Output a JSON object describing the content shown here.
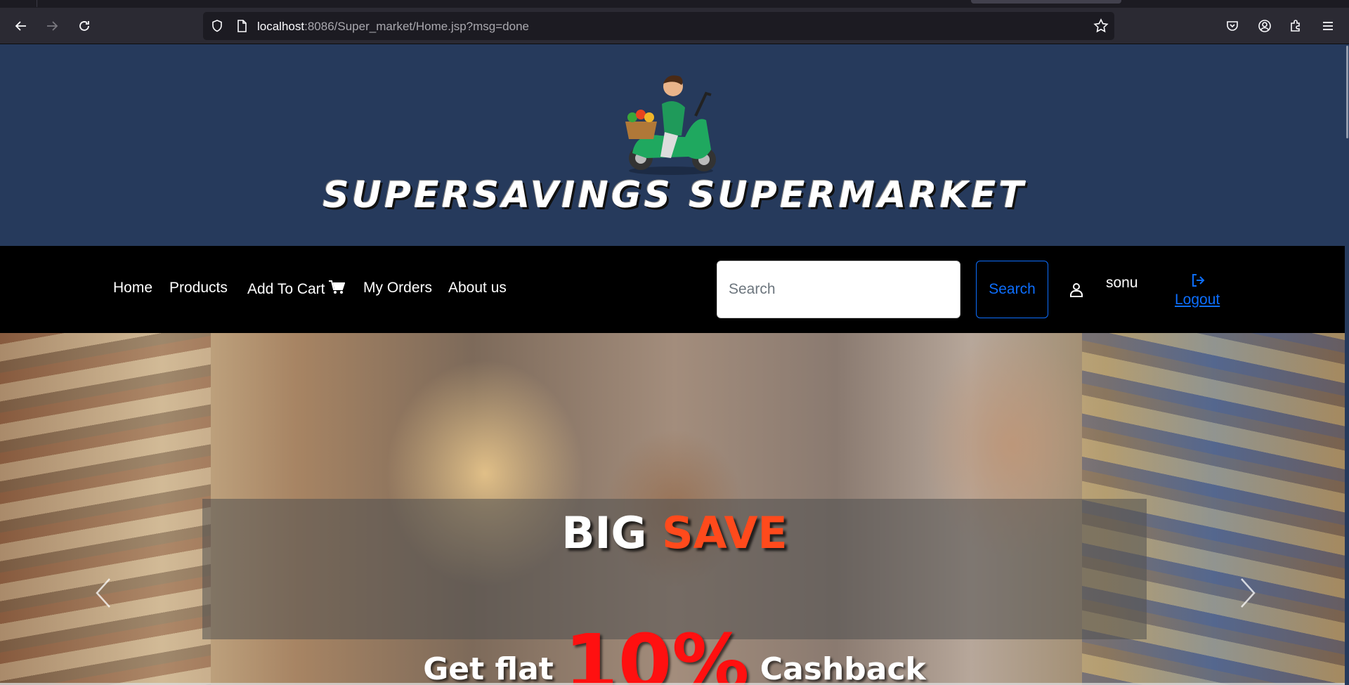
{
  "browser": {
    "url_host": "localhost",
    "url_rest": ":8086/Super_market/Home.jsp?msg=done",
    "icons": [
      "back-icon",
      "forward-icon",
      "reload-icon",
      "shield-icon",
      "page-icon",
      "bookmark-star-icon",
      "pocket-icon",
      "account-icon",
      "extensions-icon",
      "menu-icon"
    ]
  },
  "header": {
    "brand": "SUPERSAVINGS SUPERMARKET",
    "logo": "scooter-delivery-logo",
    "background": "#263a5c"
  },
  "nav": {
    "items": [
      {
        "label": "Home"
      },
      {
        "label": "Products"
      },
      {
        "label": "Add To Cart"
      },
      {
        "label": "My Orders"
      },
      {
        "label": "About us"
      }
    ],
    "search_placeholder": "Search",
    "search_button": "Search",
    "username": "sonu",
    "logout": "Logout",
    "accent": "#0d6efd"
  },
  "banner": {
    "title_part1": "BIG ",
    "title_part2": "SAVE",
    "subtitle_pre": "Get flat ",
    "subtitle_pct": "10%",
    "subtitle_post": " Cashback",
    "highlight_color": "#ff4a1c"
  }
}
